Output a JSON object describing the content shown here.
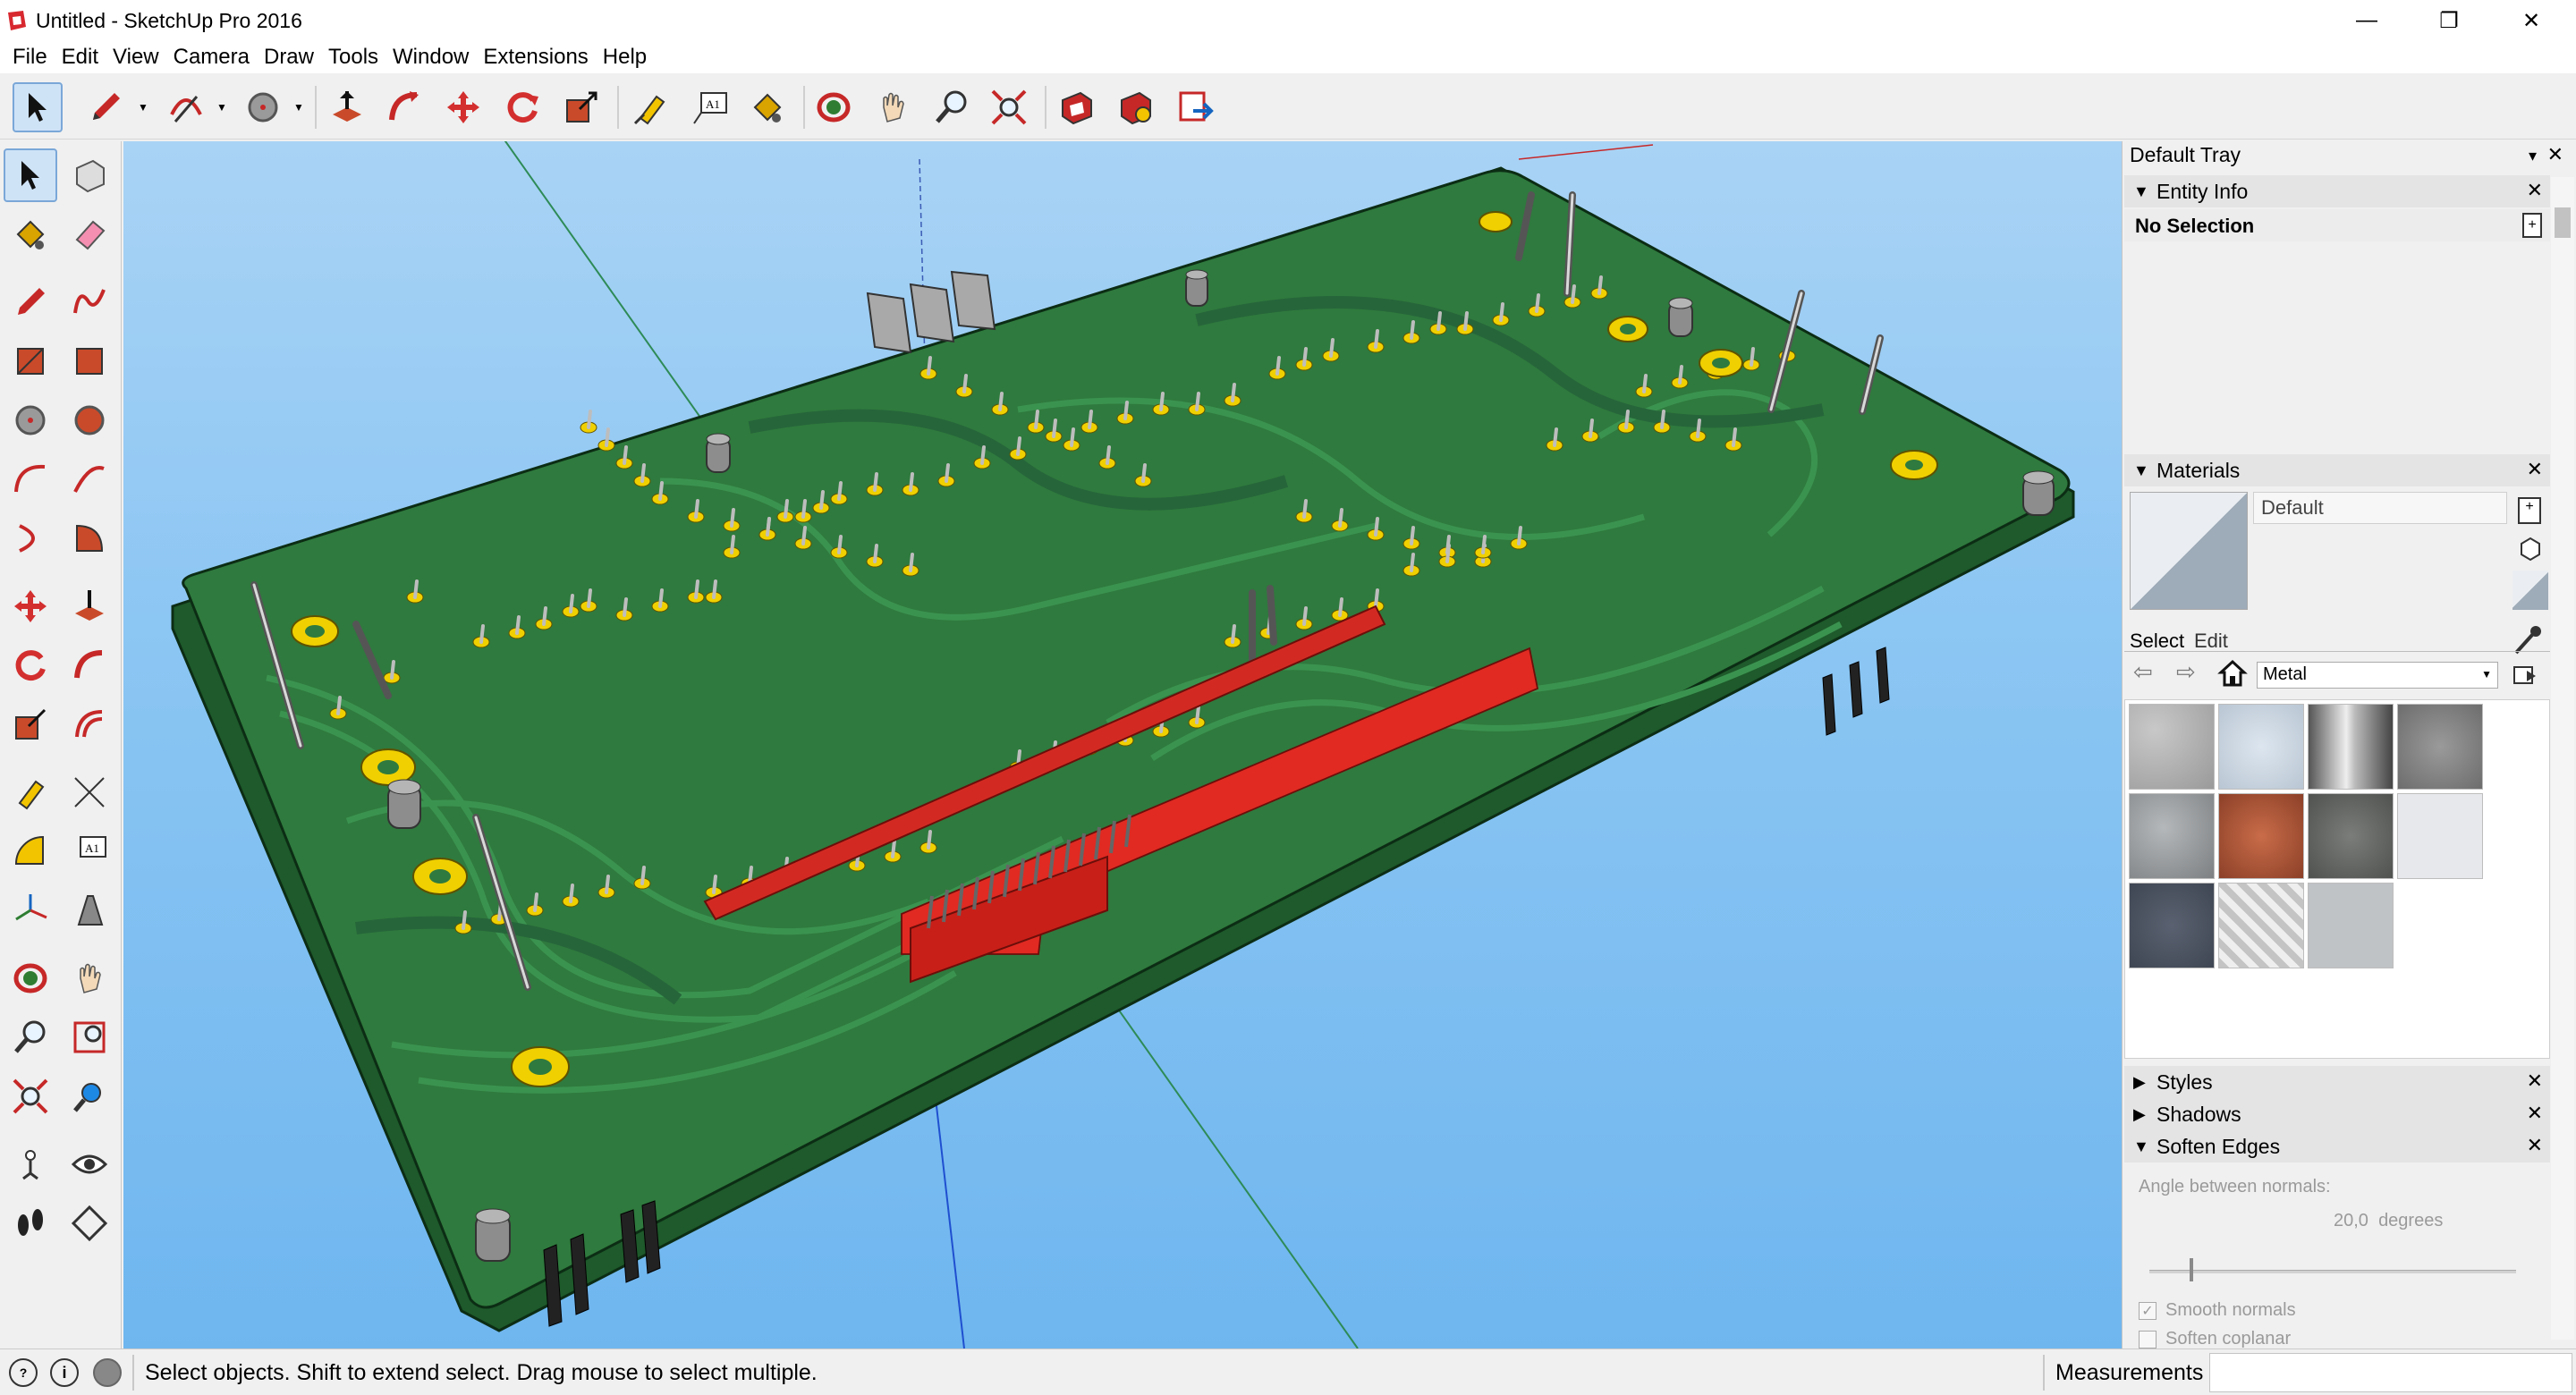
{
  "window": {
    "title": "Untitled - SketchUp Pro 2016",
    "controls": {
      "minimize": "—",
      "restore": "❐",
      "close": "✕"
    }
  },
  "menu": [
    "File",
    "Edit",
    "View",
    "Camera",
    "Draw",
    "Tools",
    "Window",
    "Extensions",
    "Help"
  ],
  "toolbar_icons": [
    "select-icon",
    "pencil-icon",
    "arc-icon",
    "circle-icon",
    "push-pull-icon",
    "follow-me-icon",
    "move-icon",
    "rotate-icon",
    "scale-icon",
    "tape-measure-icon",
    "text-icon",
    "paint-bucket-icon",
    "orbit-icon",
    "pan-icon",
    "zoom-icon",
    "zoom-extents-icon",
    "warehouse-icon",
    "extension-warehouse-icon",
    "send-to-layout-icon"
  ],
  "tray": {
    "title": "Default Tray",
    "entity_info": {
      "label": "Entity Info",
      "selection": "No Selection"
    },
    "materials": {
      "label": "Materials",
      "current_name": "Default",
      "tab_select": "Select",
      "tab_edit": "Edit",
      "library": "Metal"
    },
    "styles": {
      "label": "Styles"
    },
    "shadows": {
      "label": "Shadows"
    },
    "soften_edges": {
      "label": "Soften Edges",
      "angle_label": "Angle between normals:",
      "angle_value": "20,0",
      "angle_unit": "degrees",
      "angle_fraction": 0.11,
      "smooth_normals": "Smooth normals",
      "smooth_checked": true,
      "soften_coplanar": "Soften coplanar",
      "coplanar_checked": false
    }
  },
  "status": {
    "message": "Select objects. Shift to extend select. Drag mouse to select multiple.",
    "measurements_label": "Measurements",
    "measurements_value": ""
  },
  "colors": {
    "pcb_green": "#2f7a3e",
    "pcb_trace": "#3a8d4a",
    "pad_yellow": "#f0d000",
    "connector_red": "#e02a22",
    "sky": "#8cc6f3"
  }
}
